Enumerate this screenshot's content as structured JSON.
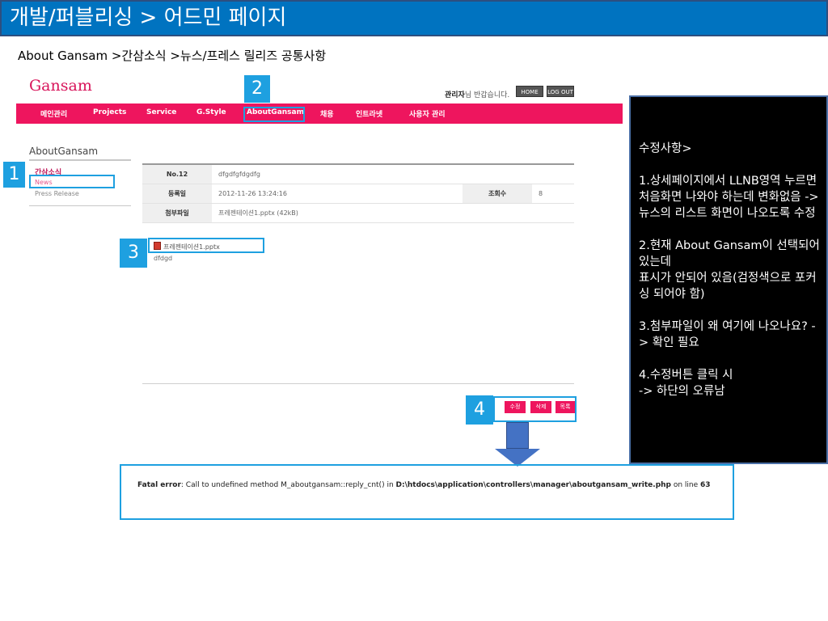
{
  "slide": {
    "title": "개발/퍼블리싱 > 어드민 페이지",
    "breadcrumb": "About Gansam >간삼소식 >뉴스/프레스 릴리즈 공통사항"
  },
  "header": {
    "logo": "Gansam",
    "welcome_bold": "관리자",
    "welcome_rest": "님 반갑습니다.",
    "home_label": "HOME",
    "logout_label": "LOG OUT"
  },
  "nav": {
    "items": [
      "메인관리",
      "Projects",
      "Service",
      "G.Style",
      "AboutGansam",
      "채용",
      "인트라넷",
      "사용자 관리"
    ]
  },
  "lnb": {
    "title": "AboutGansam",
    "sub_title": "간삼소식",
    "items": [
      "News",
      "Press Release"
    ]
  },
  "detail": {
    "no_label": "No.12",
    "no_value": "dfgdfgfdgdfg",
    "date_label": "등록일",
    "date_value": "2012-11-26 13:24:16",
    "views_label": "조회수",
    "views_value": "8",
    "attach_label": "첨부파일",
    "attach_value": "프레젠테이션1.pptx (42kB)"
  },
  "content": {
    "attachment": "프레젠테이션1.pptx",
    "body": "dfdgd"
  },
  "actions": {
    "edit": "수정",
    "delete": "삭제",
    "list": "목록"
  },
  "error": {
    "label": "Fatal error",
    "message": ": Call to undefined method M_aboutgansam::reply_cnt() in ",
    "path": "D:\\htdocs\\application\\controllers\\manager\\aboutgansam_write.php",
    "on_line": " on line ",
    "line_no": "63"
  },
  "callouts": [
    "1",
    "2",
    "3",
    "4"
  ],
  "notes": {
    "heading": "수정사항>",
    "items": [
      "1.상세페이지에서 LLNB영역 누르면 처음화면 나와야 하는데 변화없음 ->뉴스의 리스트 화면이 나오도록 수정",
      "2.현재 About Gansam이 선택되어 있는데\n표시가 안되어 있음(검정색으로 포커싱 되어야 함)",
      "3.첨부파일이 왜 여기에 나오나요? -> 확인 필요",
      "4.수정버튼 클릭 시\n-> 하단의 오류남"
    ]
  },
  "colors": {
    "slide_title_bg": "#0073c0",
    "brand_pink": "#ee155e",
    "callout_blue": "#1ea0e0",
    "arrow_blue": "#4472c4",
    "notes_bg": "#000000"
  }
}
